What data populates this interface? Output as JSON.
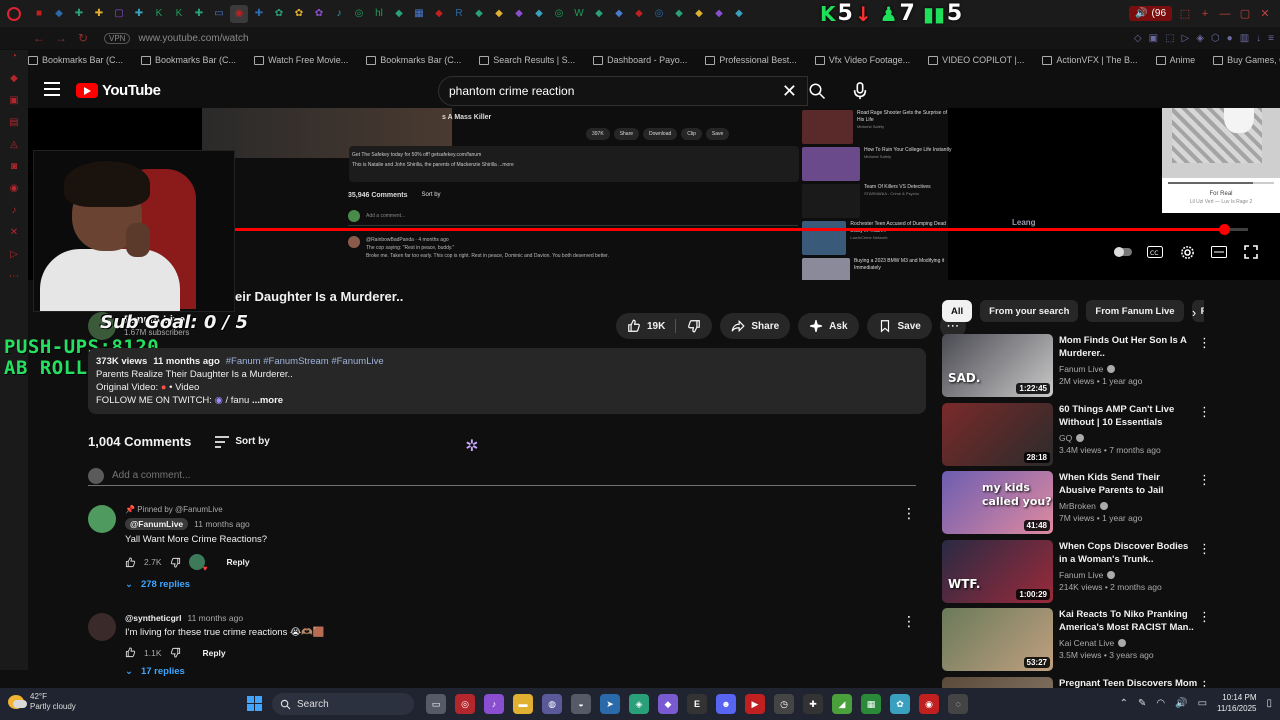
{
  "browser": {
    "tab_icons": [
      "■",
      "◆",
      "✚",
      "✚",
      "▢",
      "✚",
      "K",
      "K",
      "✚",
      "▭",
      "◉",
      "✚",
      "✿",
      "✿",
      "✿",
      "♪",
      "◎",
      "hl",
      "◆",
      "▦",
      "◆",
      "R",
      "◆",
      "◆",
      "◆",
      "◆",
      "◎",
      "W",
      "◆",
      "◆",
      "◆",
      "◎",
      "◆",
      "◆",
      "◆",
      "◆"
    ],
    "audio_tab_label": "(96",
    "stream_stats": [
      {
        "icon": "K",
        "value": "5",
        "arrow": "↓"
      },
      {
        "icon": "♟",
        "value": "7",
        "arrow": ""
      },
      {
        "icon": "▮▮",
        "value": "5",
        "arrow": ""
      }
    ],
    "vpn_label": "VPN",
    "url": "www.youtube.com/watch",
    "bookmarks": [
      "Bookmarks Bar (C...",
      "Bookmarks Bar (C...",
      "Watch Free Movie...",
      "Bookmarks Bar (C...",
      "Search Results | S...",
      "Dashboard - Payo...",
      "Professional Best...",
      "Vfx Video Footage...",
      "VIDEO COPILOT |...",
      "ActionVFX | The B...",
      "Anime",
      "Buy Games, Gift C..."
    ]
  },
  "youtube": {
    "wordmark": "YouTube",
    "search_query": "phantom crime reaction",
    "player": {
      "progress_fraction": 0.98,
      "inner": {
        "title": "s A Mass Killer",
        "actions": [
          "397K",
          "Share",
          "Download",
          "Clip",
          "Save"
        ],
        "desc_lines": [
          "Get The Safekey today for 50% off! getsafekey.com/fanum",
          "This is Natalie and John Shirilla, the parents of Mackenzie Shirilla ...more"
        ],
        "comments_count": "35,946 Comments",
        "sort_label": "Sort by",
        "add_comment": "Add a comment...",
        "comment_author": "@RainbowBadPanda · 4 months ago",
        "comment_lines": [
          "The cop saying: \"Rest in peace, buddy.\"",
          "Broke me. Taken far too early. This cop is right. Rest in peace, Dominic and Davion. You both deserved better."
        ],
        "recs": [
          {
            "title": "Road Rage Shooter Gets the Surprise of His Life",
            "meta": "Midwest Safety"
          },
          {
            "title": "How To Ruin Your College Life Instantly",
            "meta": "Midwest Safety"
          },
          {
            "title": "Team Of Killers VS Detectives",
            "meta": "STARMANIA - Crime & Psycho"
          },
          {
            "title": "Rochester Teen Accused of Dumping Dead Daisy in Trash...",
            "meta": "LawInCrime Network"
          },
          {
            "title": "Buying a 2023 BMW M3 and Modifying it Immediately",
            "meta": ""
          }
        ]
      },
      "lyrics_song": "For Real",
      "lyrics_artist": "Lil Uzi Vert — Luv Is Rage 2",
      "watermark": "Leang"
    },
    "video": {
      "title": "eir Daughter Is a Murderer..",
      "channel": "Fanum Live",
      "subs": "1.67M subscribers",
      "likes": "19K",
      "share": "Share",
      "ask": "Ask",
      "save": "Save"
    },
    "description": {
      "views": "373K views",
      "age": "11 months ago",
      "tags": "#Fanum #FanumStream #FanumLive",
      "line1": "Parents Realize Their Daughter Is a Murderer..",
      "original_label": "Original Video:",
      "original_value": "• Video",
      "follow_label": "FOLLOW ME ON TWITCH:",
      "follow_value": "/ fanu",
      "more": "...more"
    },
    "comments": {
      "count": "1,004 Comments",
      "sort_label": "Sort by",
      "placeholder": "Add a comment...",
      "items": [
        {
          "pinned": "Pinned by @FanumLive",
          "author": "@FanumLive",
          "time": "11 months ago",
          "text": "Yall Want More Crime Reactions?",
          "likes": "2.7K",
          "reply": "Reply",
          "replies": "278 replies"
        },
        {
          "author": "@syntheticgrl",
          "time": "11 months ago",
          "text": "I'm living for these true crime reactions 😭🫶🏽🟫",
          "likes": "1.1K",
          "reply": "Reply",
          "replies": "17 replies"
        }
      ]
    },
    "chips": [
      "All",
      "From your search",
      "From Fanum Live",
      "R"
    ],
    "recommendations": [
      {
        "title": "Mom Finds Out Her Son Is A Murderer..",
        "channel": "Fanum Live",
        "meta": "2M views • 1 year ago",
        "duration": "1:22:45",
        "thumb_text": "SAD.",
        "colors": [
          "#4a4a52",
          "#c9c9c9"
        ]
      },
      {
        "title": "60 Things AMP Can't Live Without | 10 Essentials",
        "channel": "GQ",
        "meta": "3.4M views • 7 months ago",
        "duration": "28:18",
        "thumb_text": "",
        "colors": [
          "#7a2a2a",
          "#2b2b2b"
        ]
      },
      {
        "title": "When Kids Send Their Abusive Parents to Jail",
        "channel": "MrBroken",
        "meta": "7M views • 1 year ago",
        "duration": "41:48",
        "thumb_text": "my kids called you?",
        "colors": [
          "#6c5db0",
          "#e08aa0"
        ]
      },
      {
        "title": "When Cops Discover Bodies in a Woman's Trunk..",
        "channel": "Fanum Live",
        "meta": "214K views • 2 months ago",
        "duration": "1:00:29",
        "thumb_text": "WTF.",
        "colors": [
          "#2a2a44",
          "#9a2a3a"
        ]
      },
      {
        "title": "Kai Reacts To Niko Pranking America's Most RACIST Man..",
        "channel": "Kai Cenat Live",
        "meta": "3.5M views • 3 years ago",
        "duration": "53:27",
        "thumb_text": "",
        "colors": [
          "#6a7a5a",
          "#c0a080"
        ]
      },
      {
        "title": "Pregnant Teen Discovers Mom",
        "channel": "",
        "meta": "",
        "duration": "",
        "thumb_text": "",
        "colors": [
          "#5a4a3a",
          "#8a7a6a"
        ]
      }
    ]
  },
  "overlay": {
    "sub_goal": "Sub Goal: 0 / 5",
    "pushups": "PUSH-UPS:8120",
    "abrolls": "AB ROLLS:240"
  },
  "taskbar": {
    "temp": "42°F",
    "condition": "Partly cloudy",
    "search_label": "Search",
    "apps": [
      {
        "glyph": "▭",
        "color": "#555a66"
      },
      {
        "glyph": "◎",
        "color": "#b3262c"
      },
      {
        "glyph": "♪",
        "color": "#8a4fd0"
      },
      {
        "glyph": "▬",
        "color": "#e0b030"
      },
      {
        "glyph": "◍",
        "color": "#5a5a9a"
      },
      {
        "glyph": "◒",
        "color": "#555a66"
      },
      {
        "glyph": "➤",
        "color": "#2a6aaa"
      },
      {
        "glyph": "◈",
        "color": "#2aa07a"
      },
      {
        "glyph": "◆",
        "color": "#7a5ad0"
      },
      {
        "glyph": "E",
        "color": "#333"
      },
      {
        "glyph": "☻",
        "color": "#5865f2"
      },
      {
        "glyph": "▶",
        "color": "#c02020"
      },
      {
        "glyph": "◷",
        "color": "#444"
      },
      {
        "glyph": "✚",
        "color": "#333"
      },
      {
        "glyph": "◢",
        "color": "#4aa03a"
      },
      {
        "glyph": "▦",
        "color": "#2a8a3a"
      },
      {
        "glyph": "✿",
        "color": "#3aa0c0"
      },
      {
        "glyph": "◉",
        "color": "#c02020"
      },
      {
        "glyph": "◌",
        "color": "#444"
      }
    ],
    "time": "10:14 PM",
    "date": "11/16/2025"
  }
}
